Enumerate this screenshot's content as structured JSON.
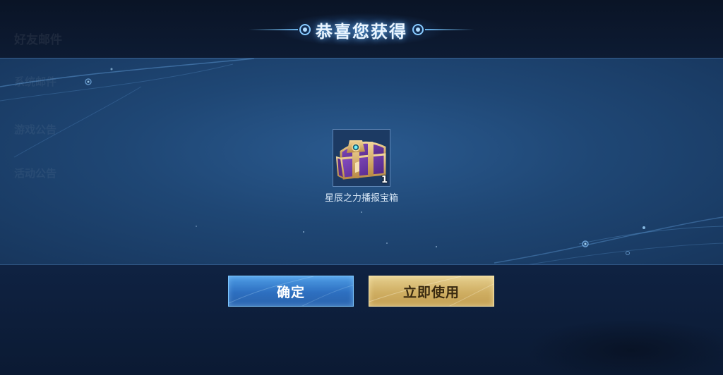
{
  "background": {
    "ghost_menu": [
      "好友邮件",
      "系统邮件",
      "游戏公告",
      "活动公告"
    ]
  },
  "title": "恭喜您获得",
  "reward": {
    "icon": "treasure-chest-icon",
    "count": "1",
    "name": "星辰之力播报宝箱"
  },
  "buttons": {
    "confirm": "确定",
    "use_now": "立即使用"
  },
  "colors": {
    "title_glow": "#6ebeff",
    "confirm_button": "#3a82d2",
    "use_button": "#d2b468"
  }
}
